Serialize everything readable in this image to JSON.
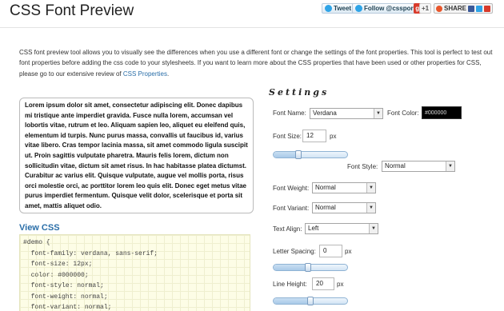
{
  "header": {
    "title": "CSS Font Preview",
    "social": {
      "tweet_label": "Tweet",
      "follow_label": "Follow @cssportal",
      "gplus_label": "g+",
      "gplus_count": "+1",
      "share_label": "SHARE"
    }
  },
  "intro": {
    "text": "CSS font preview tool allows you to visually see the differences when you use a different font or change the settings of the font properties. This tool is perfect to test out font properties before adding the css code to your stylesheets. If you want to learn more about the CSS properties that have been used or other properties for CSS, please go to our extensive review of ",
    "link_label": "CSS Properties",
    "suffix": "."
  },
  "preview": {
    "text": "Lorem ipsum dolor sit amet, consectetur adipiscing elit. Donec dapibus mi tristique ante imperdiet gravida. Fusce nulla lorem, accumsan vel lobortis vitae, rutrum et leo. Aliquam sapien leo, aliquet eu eleifend quis, elementum id turpis. Nunc purus massa, convallis ut faucibus id, varius vitae libero. Cras tempor lacinia massa, sit amet commodo ligula suscipit ut. Proin sagittis vulputate pharetra. Mauris felis lorem, dictum non sollicitudin vitae, dictum sit amet risus. In hac habitasse platea dictumst. Curabitur ac varius elit. Quisque vulputate, augue vel mollis porta, risus orci molestie orci, ac porttitor lorem leo quis elit. Donec eget metus vitae purus imperdiet fermentum. Quisque velit dolor, scelerisque et porta sit amet, mattis aliquet odio."
  },
  "css_view": {
    "heading": "View CSS",
    "lines": [
      "#demo {",
      "  font-family: verdana, sans-serif;",
      "  font-size: 12px;",
      "  color: #000000;",
      "  font-style: normal;",
      "  font-weight: normal;",
      "  font-variant: normal;"
    ]
  },
  "settings": {
    "heading": "Settings",
    "font_name": {
      "label": "Font Name:",
      "value": "Verdana"
    },
    "font_color": {
      "label": "Font Color:",
      "value": "#000000"
    },
    "font_size": {
      "label": "Font Size:",
      "value": "12",
      "unit": "px",
      "slider_level": 0.32
    },
    "font_style": {
      "label": "Font Style:",
      "value": "Normal"
    },
    "font_weight": {
      "label": "Font Weight:",
      "value": "Normal"
    },
    "font_variant": {
      "label": "Font Variant:",
      "value": "Normal"
    },
    "text_align": {
      "label": "Text Align:",
      "value": "Left"
    },
    "letter_spacing": {
      "label": "Letter Spacing:",
      "value": "0",
      "unit": "px",
      "slider_level": 0.47
    },
    "line_height": {
      "label": "Line Height:",
      "value": "20",
      "unit": "px",
      "slider_level": 0.5
    }
  },
  "colors": {
    "link": "#2a6ea8",
    "accent_blue": "#2a6ea8",
    "code_bg": "#fdfde6",
    "color_swatch": "#000000"
  },
  "icons": {
    "tweet": "twitter-bird-icon",
    "share": "share-icon",
    "dropdown": "chevron-down-icon"
  }
}
